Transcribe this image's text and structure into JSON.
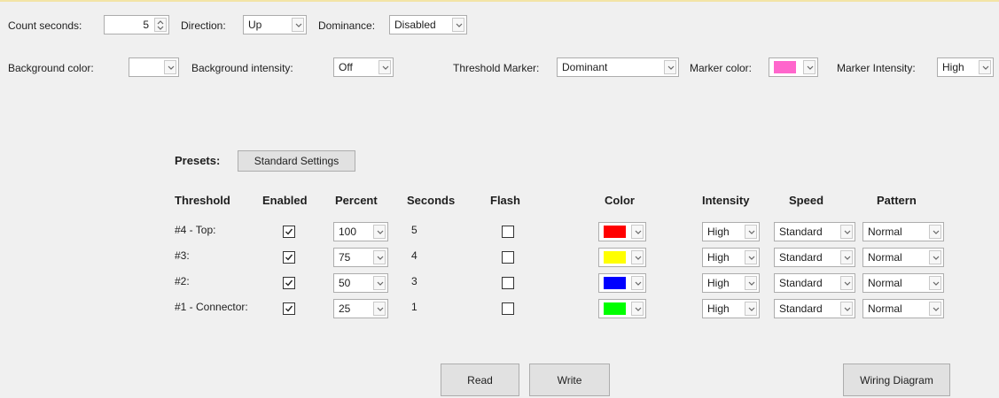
{
  "top_row": {
    "count_seconds_label": "Count seconds:",
    "count_seconds_value": "5",
    "direction_label": "Direction:",
    "direction_value": "Up",
    "dominance_label": "Dominance:",
    "dominance_value": "Disabled"
  },
  "second_row": {
    "background_color_label": "Background color:",
    "background_color_value": "#ffffff",
    "background_intensity_label": "Background intensity:",
    "background_intensity_value": "Off",
    "threshold_marker_label": "Threshold Marker:",
    "threshold_marker_value": "Dominant",
    "marker_color_label": "Marker color:",
    "marker_color_value": "#ff66cc",
    "marker_intensity_label": "Marker Intensity:",
    "marker_intensity_value": "High"
  },
  "presets": {
    "label": "Presets:",
    "standard_button": "Standard Settings"
  },
  "table": {
    "headers": {
      "threshold": "Threshold",
      "enabled": "Enabled",
      "percent": "Percent",
      "seconds": "Seconds",
      "flash": "Flash",
      "color": "Color",
      "intensity": "Intensity",
      "speed": "Speed",
      "pattern": "Pattern"
    },
    "rows": [
      {
        "threshold": "#4 - Top:",
        "enabled": true,
        "percent": "100",
        "seconds": "5",
        "flash": false,
        "color": "#ff0000",
        "intensity": "High",
        "speed": "Standard",
        "pattern": "Normal"
      },
      {
        "threshold": "#3:",
        "enabled": true,
        "percent": "75",
        "seconds": "4",
        "flash": false,
        "color": "#ffff00",
        "intensity": "High",
        "speed": "Standard",
        "pattern": "Normal"
      },
      {
        "threshold": "#2:",
        "enabled": true,
        "percent": "50",
        "seconds": "3",
        "flash": false,
        "color": "#0000ff",
        "intensity": "High",
        "speed": "Standard",
        "pattern": "Normal"
      },
      {
        "threshold": "#1 - Connector:",
        "enabled": true,
        "percent": "25",
        "seconds": "1",
        "flash": false,
        "color": "#00ff00",
        "intensity": "High",
        "speed": "Standard",
        "pattern": "Normal"
      }
    ]
  },
  "bottom_buttons": {
    "read": "Read",
    "write": "Write",
    "wiring_diagram": "Wiring Diagram"
  },
  "icons": {
    "dropdown_arrow": "chevron-down-icon",
    "spinner": "spin-up-down-icon",
    "checkmark": "checkmark-icon"
  }
}
